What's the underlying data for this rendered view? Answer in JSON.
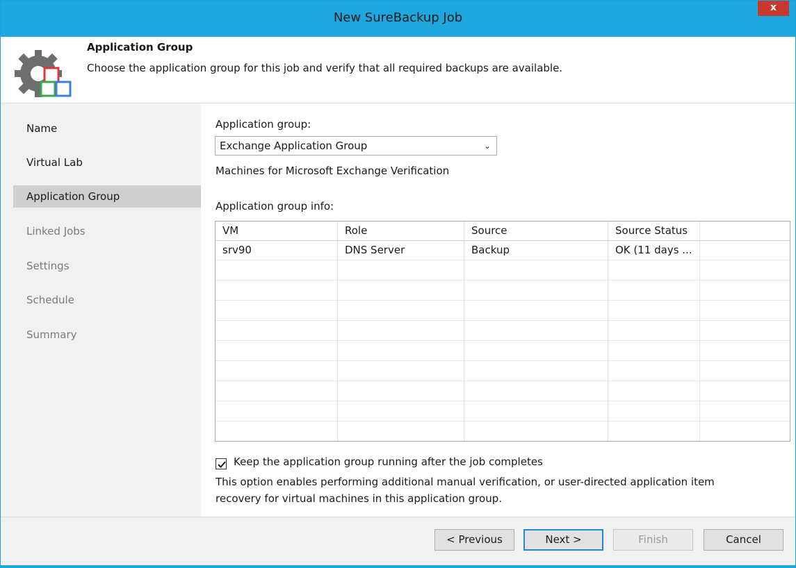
{
  "window": {
    "title": "New SureBackup Job",
    "close_label": "x"
  },
  "header": {
    "icon": "gear-backup-icon",
    "title": "Application Group",
    "description": "Choose the application group for this job and verify that all required backups are available."
  },
  "sidebar": {
    "items": [
      {
        "label": "Name",
        "state": "enabled"
      },
      {
        "label": "Virtual Lab",
        "state": "enabled"
      },
      {
        "label": "Application Group",
        "state": "active"
      },
      {
        "label": "Linked Jobs",
        "state": "disabled"
      },
      {
        "label": "Settings",
        "state": "disabled"
      },
      {
        "label": "Schedule",
        "state": "disabled"
      },
      {
        "label": "Summary",
        "state": "disabled"
      }
    ]
  },
  "main": {
    "group_label": "Application group:",
    "group_value": "Exchange Application Group",
    "group_description": "Machines for Microsoft Exchange Verification",
    "info_label": "Application group info:",
    "table": {
      "columns": [
        "VM",
        "Role",
        "Source",
        "Source Status"
      ],
      "rows": [
        [
          "srv90",
          "DNS Server",
          "Backup",
          "OK (11 days ..."
        ]
      ]
    },
    "keep_running": {
      "checked": true,
      "label": "Keep the application group running after the job completes"
    },
    "note_line1": "This option enables performing additional manual verification, or user-directed application item",
    "note_line2": "recovery for virtual machines in this application group."
  },
  "footer": {
    "previous_label": "< Previous",
    "next_label": "Next >",
    "finish_label": "Finish",
    "cancel_label": "Cancel"
  },
  "colors": {
    "accent": "#1ea6de",
    "close": "#c7382d",
    "selection": "#cfcfcf"
  }
}
